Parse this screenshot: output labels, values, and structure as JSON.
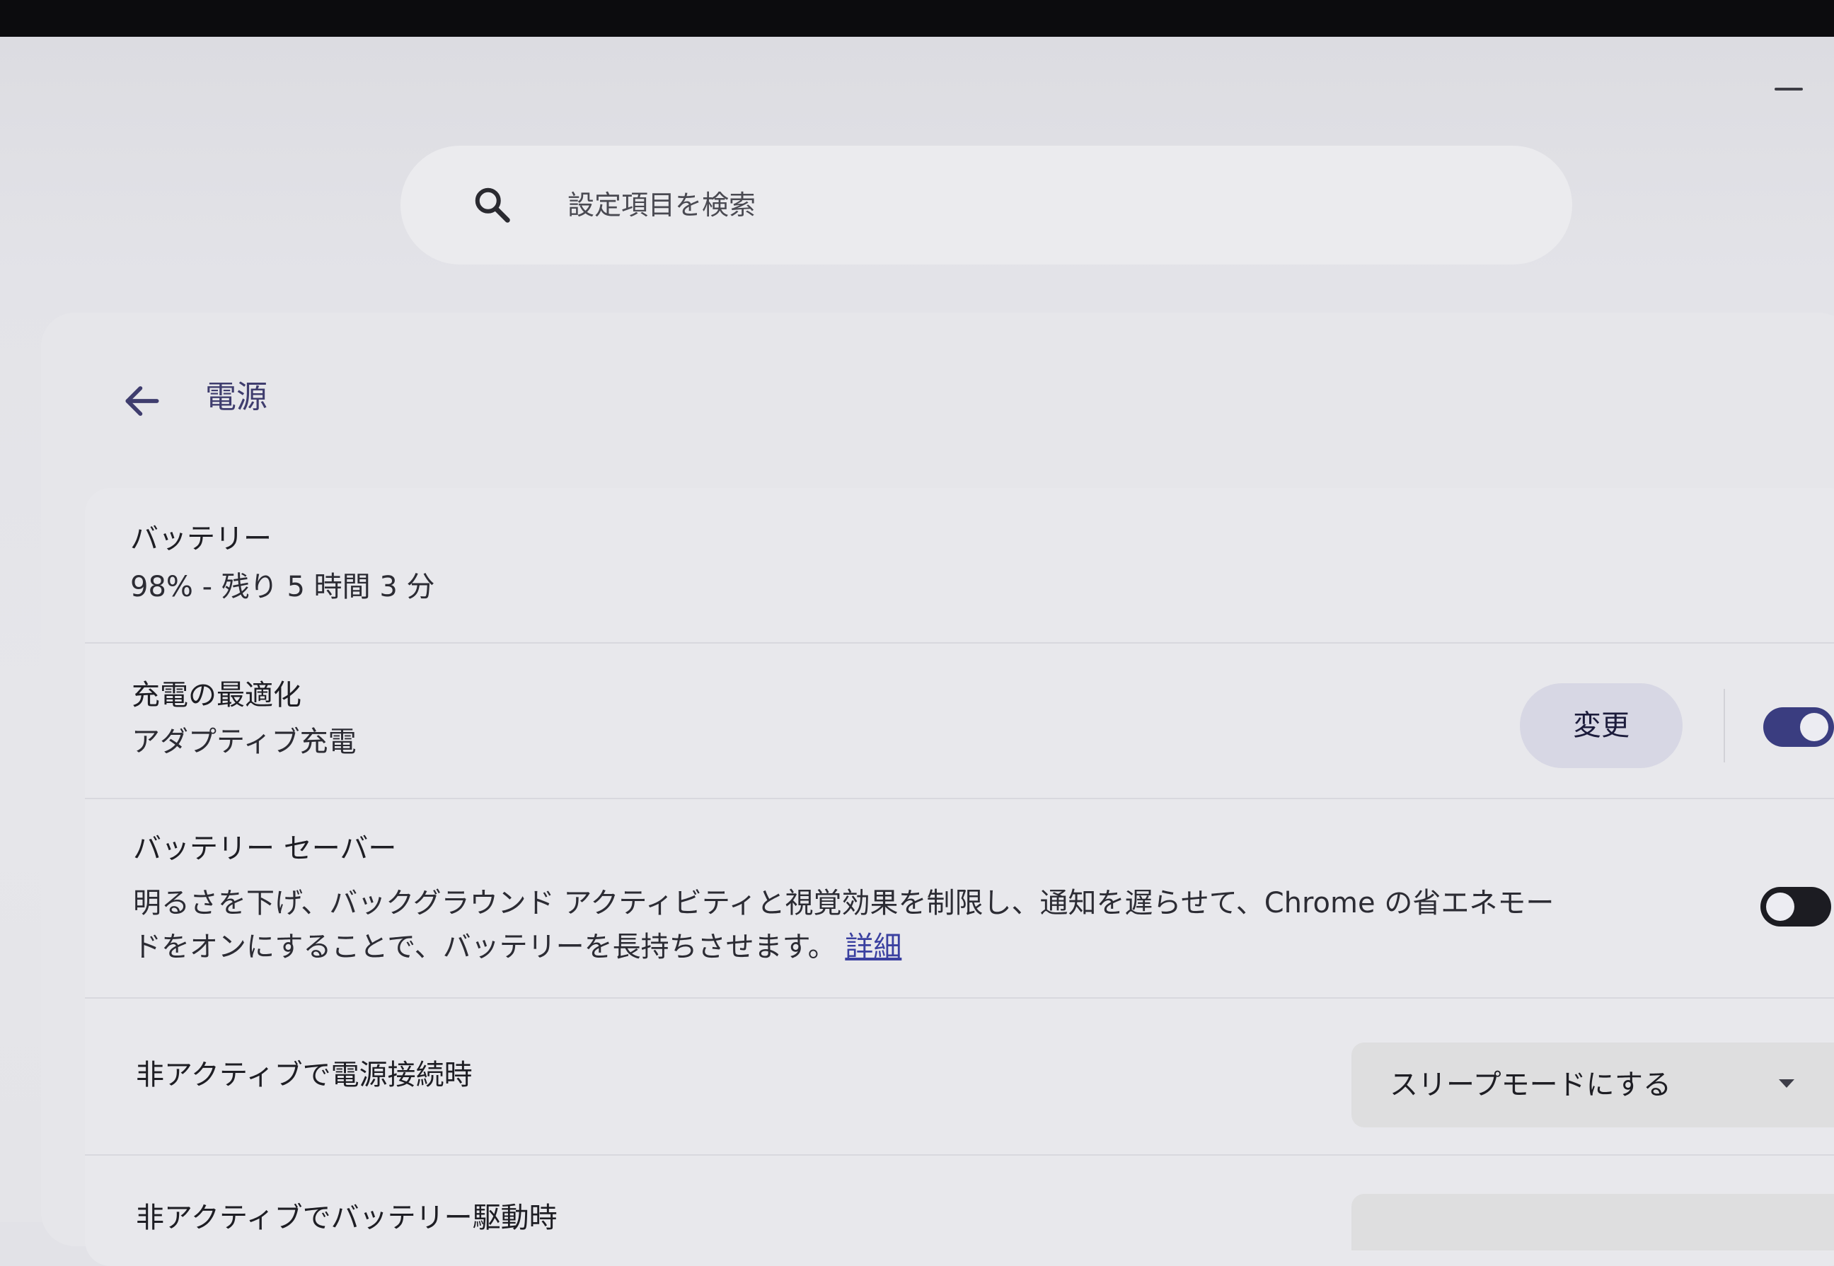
{
  "search": {
    "placeholder": "設定項目を検索"
  },
  "page": {
    "title": "電源"
  },
  "battery": {
    "title": "バッテリー",
    "status": "98% - 残り 5 時間 3 分"
  },
  "charging_optimization": {
    "title": "充電の最適化",
    "value": "アダプティブ充電",
    "change_label": "変更",
    "enabled": true
  },
  "battery_saver": {
    "title": "バッテリー セーバー",
    "description_line1": "明るさを下げ、バックグラウンド アクティビティと視覚効果を制限し、通知を遅らせて、Chrome の省エネモー",
    "description_line2": "ドをオンにすることで、バッテリーを長持ちさせます。",
    "learn_more": "詳細",
    "enabled": false
  },
  "idle_plugged_in": {
    "title": "非アクティブで電源接続時",
    "selected": "スリープモードにする"
  },
  "idle_on_battery": {
    "title": "非アクティブでバッテリー駆動時"
  },
  "colors": {
    "accent": "#3a3d80",
    "title": "#3f3d6e",
    "link": "#3a40a0"
  }
}
